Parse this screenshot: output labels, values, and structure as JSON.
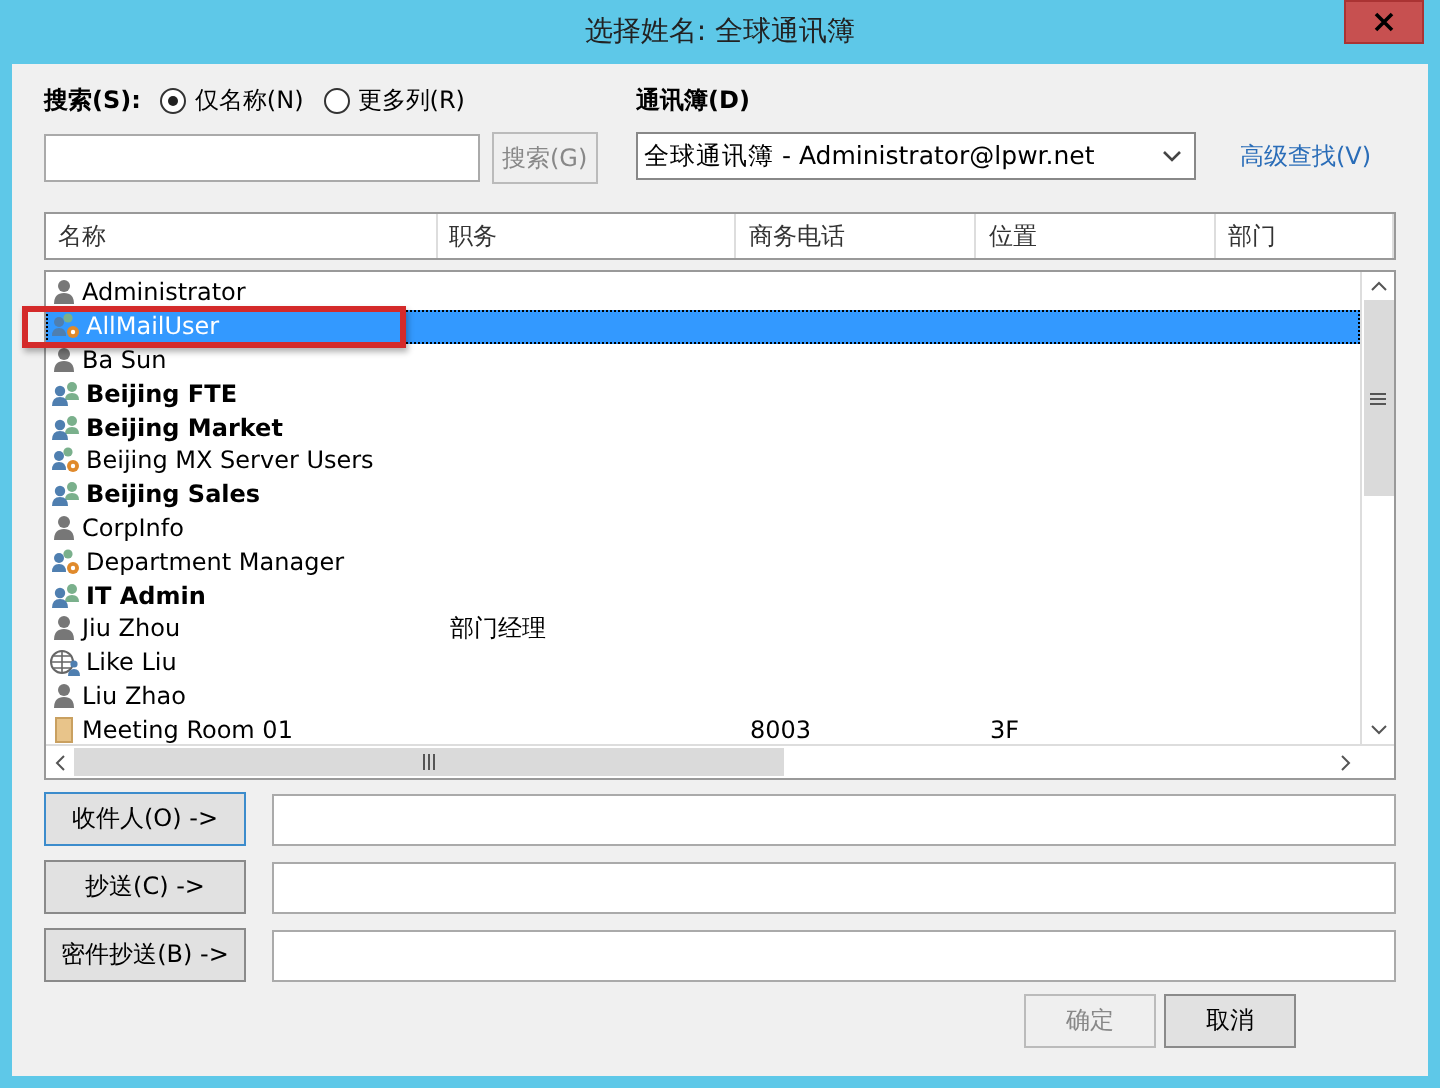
{
  "window": {
    "title": "选择姓名: 全球通讯簿"
  },
  "search": {
    "label": "搜索(S):",
    "options": [
      {
        "label": "仅名称(N)",
        "selected": true
      },
      {
        "label": "更多列(R)",
        "selected": false
      }
    ],
    "button": {
      "label": "搜索(G)",
      "disabled": true
    }
  },
  "address_book": {
    "label": "通讯簿(D)",
    "value": "全球通讯簿 - Administrator@lpwr.net",
    "link": "高级查找(V)"
  },
  "table": {
    "columns": [
      "名称",
      "职务",
      "商务电话",
      "位置",
      "部门"
    ],
    "rows": [
      {
        "kind": "user",
        "selected": false,
        "cells": [
          "Administrator"
        ]
      },
      {
        "kind": "group-gear",
        "selected": true,
        "highlighted": true,
        "cells": [
          "AllMailUser"
        ]
      },
      {
        "kind": "user",
        "selected": false,
        "cells": [
          "Ba Sun"
        ]
      },
      {
        "kind": "group",
        "selected": false,
        "cells": [
          "Beijing FTE"
        ]
      },
      {
        "kind": "group",
        "selected": false,
        "cells": [
          "Beijing Market"
        ]
      },
      {
        "kind": "group-gear",
        "selected": false,
        "cells": [
          "Beijing MX Server Users"
        ]
      },
      {
        "kind": "group",
        "selected": false,
        "cells": [
          "Beijing Sales"
        ]
      },
      {
        "kind": "user",
        "selected": false,
        "cells": [
          "CorpInfo"
        ]
      },
      {
        "kind": "group-gear",
        "selected": false,
        "cells": [
          "Department Manager"
        ]
      },
      {
        "kind": "group",
        "selected": false,
        "cells": [
          "IT Admin"
        ]
      },
      {
        "kind": "user",
        "selected": false,
        "cells": [
          "Jiu Zhou",
          "部门经理"
        ]
      },
      {
        "kind": "contact",
        "selected": false,
        "cells": [
          "Like Liu"
        ]
      },
      {
        "kind": "user",
        "selected": false,
        "cells": [
          "Liu Zhao"
        ]
      },
      {
        "kind": "room",
        "selected": false,
        "cells": [
          "Meeting Room 01",
          "",
          "8003",
          "3F"
        ]
      }
    ]
  },
  "recipients": [
    {
      "label": "收件人(O) ->",
      "selected": true
    },
    {
      "label": "抄送(C) ->",
      "selected": false
    },
    {
      "label": "密件抄送(B) ->",
      "selected": false
    }
  ],
  "buttons": [
    {
      "label": "确定",
      "disabled": true
    },
    {
      "label": "取消",
      "disabled": false
    }
  ]
}
